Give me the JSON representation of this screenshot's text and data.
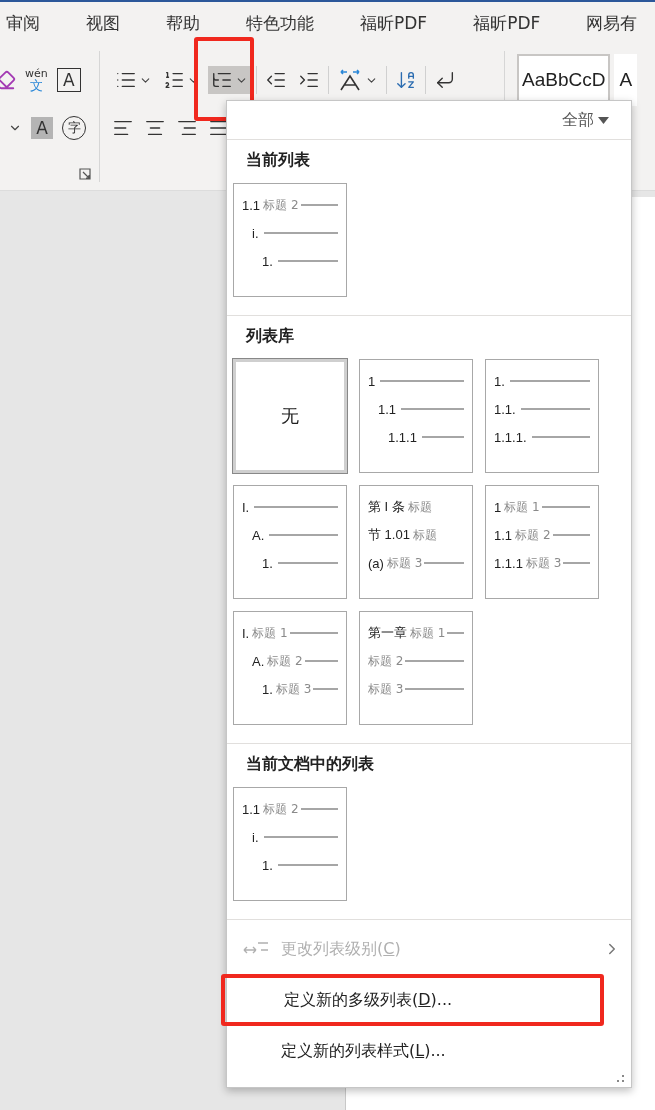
{
  "tabs": [
    {
      "label": "审阅"
    },
    {
      "label": "视图"
    },
    {
      "label": "帮助"
    },
    {
      "label": "特色功能"
    },
    {
      "label": "福昕PDF"
    },
    {
      "label": "福昕PDF"
    },
    {
      "label": "网易有"
    }
  ],
  "ribbon": {
    "font_group": {
      "row1": [
        {
          "kind": "eraser"
        },
        {
          "kind": "phonetic-guide",
          "top": "wén",
          "bottom": "文"
        },
        {
          "kind": "boxed-letter",
          "label": "A"
        }
      ],
      "row2": [
        {
          "kind": "caret"
        },
        {
          "kind": "shaded-letter",
          "label": "A"
        },
        {
          "kind": "enclosed-char",
          "label": "字"
        }
      ]
    },
    "paragraph_group": {
      "row1": [
        {
          "kind": "bullets",
          "has_dropdown": true,
          "pressed": false,
          "highlighted": false
        },
        {
          "kind": "numbering",
          "has_dropdown": true,
          "pressed": false,
          "highlighted": false
        },
        {
          "kind": "multilevel",
          "has_dropdown": true,
          "pressed": true,
          "highlighted": true
        },
        {
          "kind": "separator"
        },
        {
          "kind": "indent-decrease",
          "has_dropdown": false,
          "pressed": false,
          "highlighted": false
        },
        {
          "kind": "indent-increase",
          "has_dropdown": false,
          "pressed": false,
          "highlighted": false
        },
        {
          "kind": "separator"
        },
        {
          "kind": "asian-layout",
          "has_dropdown": true,
          "pressed": false,
          "highlighted": false
        },
        {
          "kind": "separator"
        },
        {
          "kind": "sort",
          "has_dropdown": false,
          "pressed": false,
          "highlighted": false
        },
        {
          "kind": "separator"
        },
        {
          "kind": "show-marks",
          "has_dropdown": false,
          "pressed": false,
          "highlighted": false
        }
      ],
      "row2": [
        {
          "kind": "align-left"
        },
        {
          "kind": "align-center"
        },
        {
          "kind": "align-right"
        },
        {
          "kind": "justify"
        }
      ]
    },
    "styles": [
      {
        "sample": "AaBbCcD",
        "selected": true
      },
      {
        "sample": "A",
        "selected": false
      }
    ]
  },
  "menu": {
    "filter": "全部",
    "sections": [
      {
        "title": "当前列表",
        "tiles": [
          {
            "kind": "preview",
            "selected": false,
            "indented": true,
            "lines": [
              {
                "number": "1.1",
                "label": "标题 2",
                "rule": true
              },
              {
                "number": "i.",
                "rule": true
              },
              {
                "number": "1.",
                "rule": true
              }
            ]
          }
        ]
      },
      {
        "title": "列表库",
        "tiles": [
          {
            "kind": "none",
            "label": "无",
            "selected": true
          },
          {
            "kind": "preview",
            "selected": false,
            "indented": true,
            "lines": [
              {
                "number": "1",
                "rule": true
              },
              {
                "number": "1.1",
                "rule": true
              },
              {
                "number": "1.1.1",
                "rule": true
              }
            ]
          },
          {
            "kind": "preview",
            "selected": false,
            "indented": false,
            "lines": [
              {
                "number": "1.",
                "rule": true
              },
              {
                "number": "1.1.",
                "rule": true
              },
              {
                "number": "1.1.1.",
                "rule": true
              }
            ]
          },
          {
            "kind": "preview",
            "selected": false,
            "indented": true,
            "lines": [
              {
                "number": "I.",
                "rule": true
              },
              {
                "number": "A.",
                "rule": true
              },
              {
                "number": "1.",
                "rule": true
              }
            ]
          },
          {
            "kind": "preview",
            "selected": false,
            "indented": false,
            "lines": [
              {
                "number": "第 I 条",
                "label": "标题",
                "rule": false
              },
              {
                "number": "节 1.01",
                "label": "标题",
                "rule": false
              },
              {
                "number": "(a)",
                "label": "标题 3",
                "rule": true
              }
            ]
          },
          {
            "kind": "preview",
            "selected": false,
            "indented": false,
            "lines": [
              {
                "number": "1",
                "label": "标题 1",
                "rule": true
              },
              {
                "number": "1.1",
                "label": "标题 2",
                "rule": true
              },
              {
                "number": "1.1.1",
                "label": "标题 3",
                "rule": true
              }
            ]
          },
          {
            "kind": "preview",
            "selected": false,
            "indented": true,
            "lines": [
              {
                "number": "I.",
                "label": "标题 1",
                "rule": true
              },
              {
                "number": "A.",
                "label": "标题 2",
                "rule": true
              },
              {
                "number": "1.",
                "label": "标题 3",
                "rule": true
              }
            ]
          },
          {
            "kind": "preview",
            "selected": false,
            "indented": false,
            "lines": [
              {
                "number": "第一章",
                "label": "标题 1",
                "rule": true
              },
              {
                "label": "标题 2",
                "rule": true
              },
              {
                "label": "标题 3",
                "rule": true
              }
            ]
          }
        ]
      },
      {
        "title": "当前文档中的列表",
        "tiles": [
          {
            "kind": "preview",
            "selected": false,
            "indented": true,
            "lines": [
              {
                "number": "1.1",
                "label": "标题 2",
                "rule": true
              },
              {
                "number": "i.",
                "rule": true
              },
              {
                "number": "1.",
                "rule": true
              }
            ]
          }
        ]
      }
    ],
    "items": [
      {
        "kind": "submenu",
        "before": "更改列表级别(",
        "key": "C",
        "after": ")",
        "disabled": true,
        "highlighted": false
      },
      {
        "kind": "command",
        "before": "定义新的多级列表(",
        "key": "D",
        "after": ")...",
        "disabled": false,
        "highlighted": true
      },
      {
        "kind": "command",
        "before": "定义新的列表样式(",
        "key": "L",
        "after": ")...",
        "disabled": false,
        "highlighted": false
      }
    ]
  }
}
